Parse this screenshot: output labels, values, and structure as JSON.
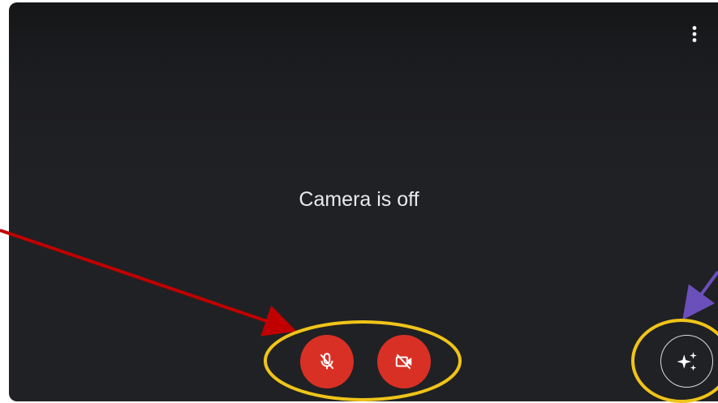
{
  "preview": {
    "status_text": "Camera is off",
    "background_color": "#202124"
  },
  "controls": {
    "more_options_icon": "more-vert-icon",
    "microphone_button": {
      "icon": "mic-off-icon",
      "state": "off",
      "color": "#d93025"
    },
    "camera_button": {
      "icon": "videocam-off-icon",
      "state": "off",
      "color": "#d93025"
    },
    "effects_button": {
      "icon": "sparkle-icon"
    }
  },
  "annotations": {
    "red_arrow_color": "#c00000",
    "purple_arrow_color": "#6b4fbb",
    "highlight_ellipse_color": "#f0c419"
  }
}
